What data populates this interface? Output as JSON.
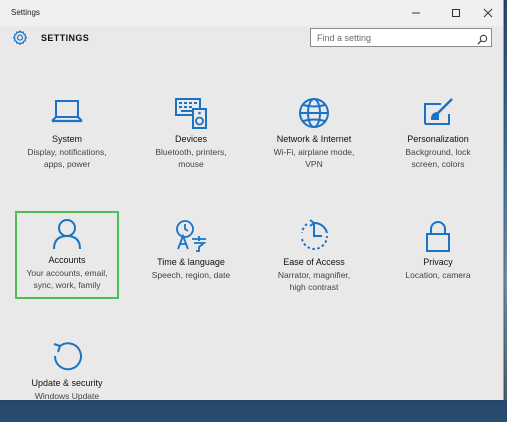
{
  "window": {
    "title": "Settings"
  },
  "header": {
    "title": "SETTINGS",
    "search_placeholder": "Find a setting"
  },
  "tiles": [
    {
      "name": "System",
      "desc1": "Display, notifications,",
      "desc2": "apps, power",
      "desc3": ""
    },
    {
      "name": "Devices",
      "desc1": "Bluetooth, printers,",
      "desc2": "mouse",
      "desc3": ""
    },
    {
      "name": "Network & Internet",
      "desc1": "Wi-Fi, airplane mode,",
      "desc2": "VPN",
      "desc3": ""
    },
    {
      "name": "Personalization",
      "desc1": "Background, lock",
      "desc2": "screen, colors",
      "desc3": ""
    },
    {
      "name": "Accounts",
      "desc1": "Your accounts, email,",
      "desc2": "sync, work, family",
      "desc3": ""
    },
    {
      "name": "Time & language",
      "desc1": "Speech, region, date",
      "desc2": "",
      "desc3": ""
    },
    {
      "name": "Ease of Access",
      "desc1": "Narrator, magnifier,",
      "desc2": "high contrast",
      "desc3": ""
    },
    {
      "name": "Privacy",
      "desc1": "Location, camera",
      "desc2": "",
      "desc3": ""
    },
    {
      "name": "Update & security",
      "desc1": "Windows Update",
      "desc2": "",
      "desc3": ""
    }
  ],
  "colors": {
    "accent": "#1a73c7",
    "selection": "#4fbd53"
  },
  "icons": [
    "laptop-icon",
    "keyboard-speaker-icon",
    "globe-icon",
    "paintbrush-icon",
    "person-icon",
    "language-icon",
    "ease-of-access-icon",
    "lock-icon",
    "refresh-icon"
  ]
}
